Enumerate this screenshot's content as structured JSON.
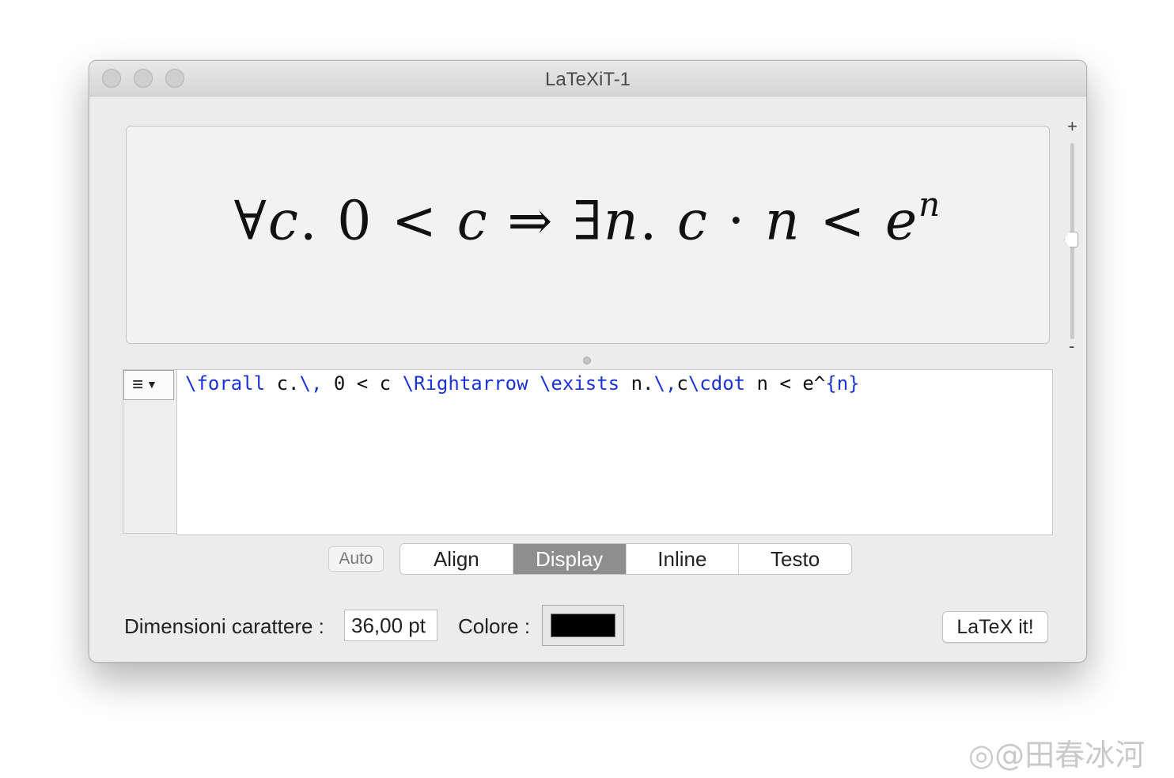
{
  "window": {
    "title": "LaTeXiT-1",
    "traffic_lights": [
      "close",
      "minimize",
      "zoom"
    ]
  },
  "preview": {
    "formula_parts": {
      "forall": "∀",
      "c1": "c",
      "dot1": ".",
      "zero": "0",
      "lt1": "<",
      "c2": "c",
      "implies": "⇒",
      "exists": "∃",
      "n1": "n",
      "dot2": ".",
      "c3": "c",
      "cdot": "·",
      "n2": "n",
      "lt2": "<",
      "e": "e",
      "exp": "n"
    },
    "zoom_plus": "+",
    "zoom_minus": "-"
  },
  "editor": {
    "menu_icon": "lines-menu-icon",
    "code_tokens": [
      {
        "text": "\\forall",
        "kind": "command"
      },
      {
        "text": " c.",
        "kind": "plain"
      },
      {
        "text": "\\,",
        "kind": "command"
      },
      {
        "text": " 0 < c ",
        "kind": "plain"
      },
      {
        "text": "\\Rightarrow",
        "kind": "command"
      },
      {
        "text": " ",
        "kind": "plain"
      },
      {
        "text": "\\exists",
        "kind": "command"
      },
      {
        "text": " n.",
        "kind": "plain"
      },
      {
        "text": "\\,",
        "kind": "command"
      },
      {
        "text": "c",
        "kind": "plain"
      },
      {
        "text": "\\cdot",
        "kind": "command"
      },
      {
        "text": " n < e^",
        "kind": "plain"
      },
      {
        "text": "{n}",
        "kind": "command"
      }
    ]
  },
  "mode": {
    "auto_label": "Auto",
    "options": [
      "Align",
      "Display",
      "Inline",
      "Testo"
    ],
    "selected": "Display"
  },
  "footer": {
    "size_label": "Dimensioni carattere :",
    "size_value": "36,00 pt",
    "color_label": "Colore :",
    "color_value": "#000000",
    "latex_button": "LaTeX it!"
  },
  "watermark": "@田春冰河"
}
